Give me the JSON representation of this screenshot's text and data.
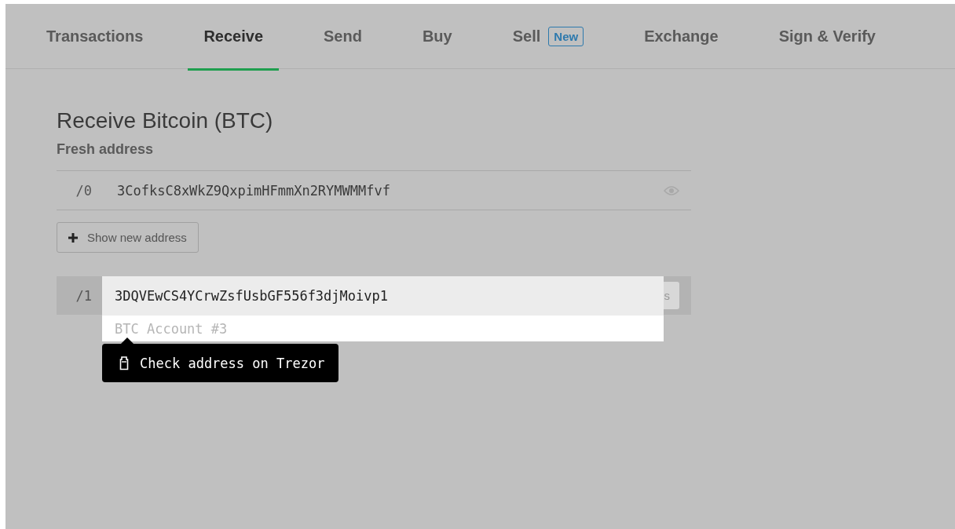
{
  "tabs": [
    {
      "label": "Transactions",
      "selected": false
    },
    {
      "label": "Receive",
      "selected": true
    },
    {
      "label": "Send",
      "selected": false
    },
    {
      "label": "Buy",
      "selected": false
    },
    {
      "label": "Sell",
      "selected": false,
      "badge": "New"
    },
    {
      "label": "Exchange",
      "selected": false
    },
    {
      "label": "Sign & Verify",
      "selected": false
    }
  ],
  "heading": "Receive Bitcoin (BTC)",
  "subheading": "Fresh address",
  "fresh_address": {
    "path": "/0",
    "address": "3CofksC8xWkZ9QxpimHFmmXn2RYMWMMfvf"
  },
  "show_new_button": "Show new address",
  "revealed_address": {
    "path": "/1",
    "hidden_button_fragment": "s"
  },
  "popup": {
    "address": "3DQVEwCS4YCrwZsfUsbGF556f3djMoivp1",
    "account": "BTC Account #3"
  },
  "tooltip": "Check address on Trezor"
}
